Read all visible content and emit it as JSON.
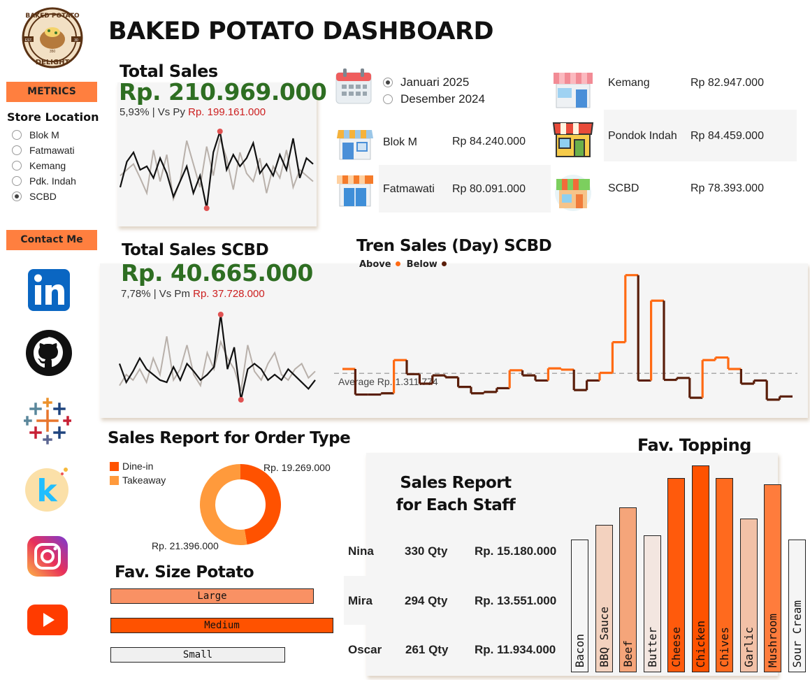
{
  "title": "BAKED POTATO DASHBOARD",
  "logo": {
    "top": "BAKED POTATO",
    "bottom": "DELIGHT",
    "est": "EST.",
    "est_num": "30",
    "left": "EST.",
    "right": "350"
  },
  "sidebar": {
    "metrics_label": "METRICS",
    "store_location_label": "Store Location",
    "stores": [
      {
        "label": "Blok M",
        "selected": false
      },
      {
        "label": "Fatmawati",
        "selected": false
      },
      {
        "label": "Kemang",
        "selected": false
      },
      {
        "label": "Pdk. Indah",
        "selected": false
      },
      {
        "label": "SCBD",
        "selected": true
      }
    ],
    "contact_label": "Contact Me",
    "socials": [
      "linkedin-icon",
      "github-icon",
      "tableau-icon",
      "kaggle-icon",
      "instagram-icon",
      "youtube-icon"
    ]
  },
  "total_sales": {
    "title": "Total Sales",
    "value": "Rp. 210.969.000",
    "growth": "5,93% | Vs Py",
    "prev": "Rp. 199.161.000"
  },
  "period": {
    "options": [
      {
        "label": "Januari 2025",
        "selected": true
      },
      {
        "label": "Desember 2024",
        "selected": false
      }
    ]
  },
  "stores": [
    {
      "name": "Blok M",
      "value": "Rp 84.240.000"
    },
    {
      "name": "Fatmawati",
      "value": "Rp 80.091.000"
    },
    {
      "name": "Kemang",
      "value": "Rp 82.947.000"
    },
    {
      "name": "Pondok Indah",
      "value": "Rp 84.459.000"
    },
    {
      "name": "SCBD",
      "value": "Rp 78.393.000"
    }
  ],
  "scbd_sales": {
    "title": "Total Sales SCBD",
    "value": "Rp. 40.665.000",
    "growth": "7,78% | Vs Pm",
    "prev": "Rp. 37.728.000"
  },
  "trend": {
    "title": "Tren Sales (Day) SCBD",
    "legend_above": "Above",
    "legend_below": "Below",
    "average_label": "Average Rp. 1.311.774",
    "colors": {
      "above": "#ff6a13",
      "below": "#5a1e0a"
    }
  },
  "order_type": {
    "title": "Sales Report for Order Type",
    "dine_in_label": "Dine-in",
    "takeaway_label": "Takeaway",
    "dine_in_value": "Rp. 19.269.000",
    "takeaway_value": "Rp. 21.396.000"
  },
  "size": {
    "title": "Fav. Size Potato",
    "bars": [
      {
        "label": "Large"
      },
      {
        "label": "Medium"
      },
      {
        "label": "Small"
      }
    ]
  },
  "staff": {
    "title_line1": "Sales Report",
    "title_line2": "for Each Staff",
    "rows": [
      {
        "name": "Nina",
        "qty": "330 Qty",
        "value": "Rp. 15.180.000"
      },
      {
        "name": "Mira",
        "qty": "294 Qty",
        "value": "Rp. 13.551.000"
      },
      {
        "name": "Oscar",
        "qty": "261 Qty",
        "value": "Rp. 11.934.000"
      }
    ]
  },
  "topping": {
    "title": "Fav. Topping",
    "items": [
      "Bacon",
      "BBQ Sauce",
      "Beef",
      "Butter",
      "Cheese",
      "Chicken",
      "Chives",
      "Garlic",
      "Mushroom",
      "Sour Cream"
    ]
  },
  "chart_data": [
    {
      "type": "line",
      "name": "total-sales-sparkline",
      "series": [
        {
          "values": [
            30,
            52,
            60,
            45,
            48,
            38,
            55,
            42,
            22,
            35,
            48,
            25,
            40,
            12,
            60,
            78,
            45,
            58,
            48,
            55,
            68,
            42,
            50,
            40,
            58,
            45,
            72,
            38,
            55,
            50
          ]
        },
        {
          "values": [
            40,
            45,
            50,
            38,
            25,
            62,
            35,
            58,
            20,
            35,
            70,
            50,
            30,
            65,
            40,
            72,
            55,
            28,
            60,
            42,
            35,
            55,
            25,
            48,
            38,
            62,
            30,
            45,
            40,
            35
          ]
        }
      ]
    },
    {
      "type": "line",
      "name": "scbd-sales-sparkline",
      "series": [
        {
          "values": [
            45,
            28,
            38,
            50,
            40,
            35,
            30,
            28,
            42,
            30,
            45,
            38,
            30,
            35,
            42,
            90,
            40,
            60,
            12,
            40,
            45,
            40,
            30,
            35,
            30,
            40,
            34,
            28,
            22,
            30
          ]
        },
        {
          "values": [
            25,
            35,
            30,
            40,
            28,
            50,
            35,
            70,
            30,
            40,
            62,
            35,
            25,
            55,
            40,
            65,
            50,
            40,
            20,
            62,
            38,
            30,
            45,
            55,
            35,
            30,
            40,
            45,
            32,
            38
          ]
        }
      ]
    },
    {
      "type": "line",
      "title": "Tren Sales (Day) SCBD",
      "average": 1311774,
      "values": [
        1380000,
        980000,
        980000,
        1000000,
        1520000,
        1300000,
        1150000,
        1280000,
        1250000,
        1100000,
        1000000,
        1020000,
        1080000,
        1360000,
        1280000,
        1200000,
        1390000,
        1370000,
        1050000,
        1200000,
        1320000,
        1800000,
        2850000,
        1200000,
        2450000,
        1210000,
        1240000,
        930000,
        1520000,
        1560000,
        1380000,
        1150000,
        1200000,
        900000,
        950000
      ],
      "ylim": [
        800000,
        3000000
      ]
    },
    {
      "type": "pie",
      "title": "Sales Report for Order Type",
      "categories": [
        "Dine-in",
        "Takeaway"
      ],
      "values": [
        19269000,
        21396000
      ]
    },
    {
      "type": "bar",
      "title": "Fav. Size Potato",
      "categories": [
        "Large",
        "Medium",
        "Small"
      ],
      "values": [
        0.91,
        0.996,
        0.78
      ],
      "colors": [
        "#f99164",
        "#ff5200",
        "#f0f0f0"
      ]
    },
    {
      "type": "bar",
      "title": "Fav. Topping",
      "categories": [
        "Bacon",
        "BBQ Sauce",
        "Beef",
        "Butter",
        "Cheese",
        "Chicken",
        "Chives",
        "Garlic",
        "Mushroom",
        "Sour Cream"
      ],
      "values": [
        0.63,
        0.7,
        0.78,
        0.65,
        0.92,
        0.98,
        0.92,
        0.73,
        0.89,
        0.63
      ],
      "colors": [
        "#f5f5f5",
        "#f3d2bf",
        "#f5a57a",
        "#f3e6e0",
        "#ff5a0c",
        "#ff5200",
        "#ff6a1e",
        "#f2c1a7",
        "#ff7c3c",
        "#f5f5f5"
      ]
    }
  ]
}
